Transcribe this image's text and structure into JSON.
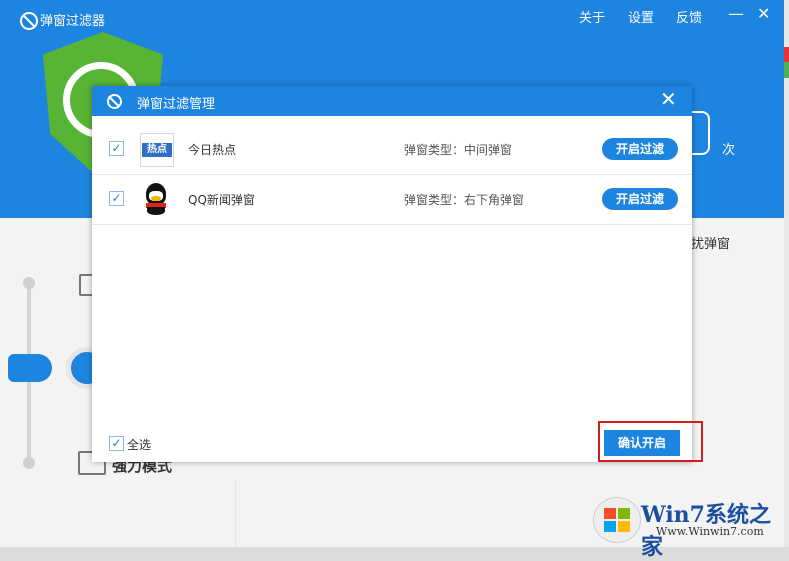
{
  "app": {
    "title": "弹窗过滤器",
    "nav": {
      "about": "关于",
      "settings": "设置",
      "feedback": "反馈"
    },
    "window_controls": {
      "minimize": "—",
      "close": "✕"
    },
    "counter_unit": "次",
    "tail_text": "扰弹窗",
    "mode_label": "強力模式"
  },
  "dialog": {
    "title": "弹窗过滤管理",
    "close": "✕",
    "rows": [
      {
        "checked": "✓",
        "name": "今日热点",
        "icon_text": "热点",
        "type": "弹窗类型：中间弹窗",
        "action": "开启过滤"
      },
      {
        "checked": "✓",
        "name": "QQ新闻弹窗",
        "type": "弹窗类型：右下角弹窗",
        "action": "开启过滤"
      }
    ],
    "select_all": {
      "checked": "✓",
      "label": "全选"
    },
    "confirm": "确认开启"
  },
  "watermark": {
    "brand": "Win7系统之家",
    "url": "Www.Winwin7.com"
  },
  "colors": {
    "primary": "#1d85e0",
    "shield": "#57b435",
    "highlight": "#d61d1d"
  }
}
